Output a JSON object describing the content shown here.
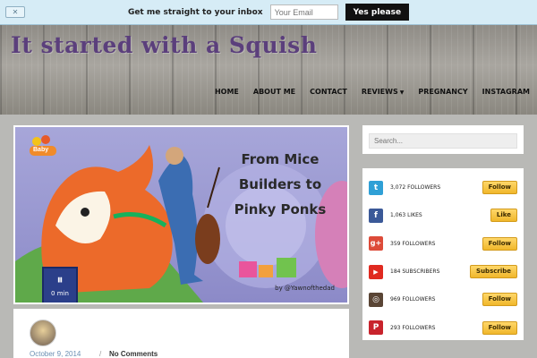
{
  "signup": {
    "close_label": "✕",
    "text": "Get me straight to your inbox",
    "email_placeholder": "Your Email",
    "button_label": "Yes please"
  },
  "site": {
    "title": "It started with a Squish"
  },
  "nav": {
    "items": [
      {
        "label": "HOME"
      },
      {
        "label": "ABOUT ME"
      },
      {
        "label": "CONTACT"
      },
      {
        "label": "REVIEWS"
      },
      {
        "label": "PREGNANCY"
      },
      {
        "label": "INSTAGRAM"
      }
    ],
    "reviews_caret": "▼"
  },
  "post": {
    "image_title_1": "From Mice",
    "image_title_2": "Builders to",
    "image_title_3": "Pinky Ponks",
    "credit": "by @Yawnofthedad",
    "logo_text": "Baby",
    "duration_icon": "⏸",
    "duration_text": "0 min",
    "date": "October 9, 2014",
    "separator": "/",
    "comments": "No Comments"
  },
  "sidebar": {
    "search_placeholder": "Search...",
    "social": [
      {
        "network": "twitter",
        "icon": "twitter-icon",
        "glyph": "t",
        "color": "#2fa0d6",
        "count": "3,072 FOLLOWERS",
        "button": "Follow"
      },
      {
        "network": "facebook",
        "icon": "facebook-icon",
        "glyph": "f",
        "color": "#3b5998",
        "count": "1,063 LIKES",
        "button": "Like"
      },
      {
        "network": "googleplus",
        "icon": "google-plus-icon",
        "glyph": "g+",
        "color": "#dd4b39",
        "count": "359 FOLLOWERS",
        "button": "Follow"
      },
      {
        "network": "youtube",
        "icon": "youtube-icon",
        "glyph": "▶",
        "color": "#e02a20",
        "count": "184 SUBSCRIBERS",
        "button": "Subscribe"
      },
      {
        "network": "instagram",
        "icon": "instagram-icon",
        "glyph": "◎",
        "color": "#5a4535",
        "count": "969 FOLLOWERS",
        "button": "Follow"
      },
      {
        "network": "pinterest",
        "icon": "pinterest-icon",
        "glyph": "P",
        "color": "#c8232c",
        "count": "293 FOLLOWERS",
        "button": "Follow"
      }
    ]
  }
}
